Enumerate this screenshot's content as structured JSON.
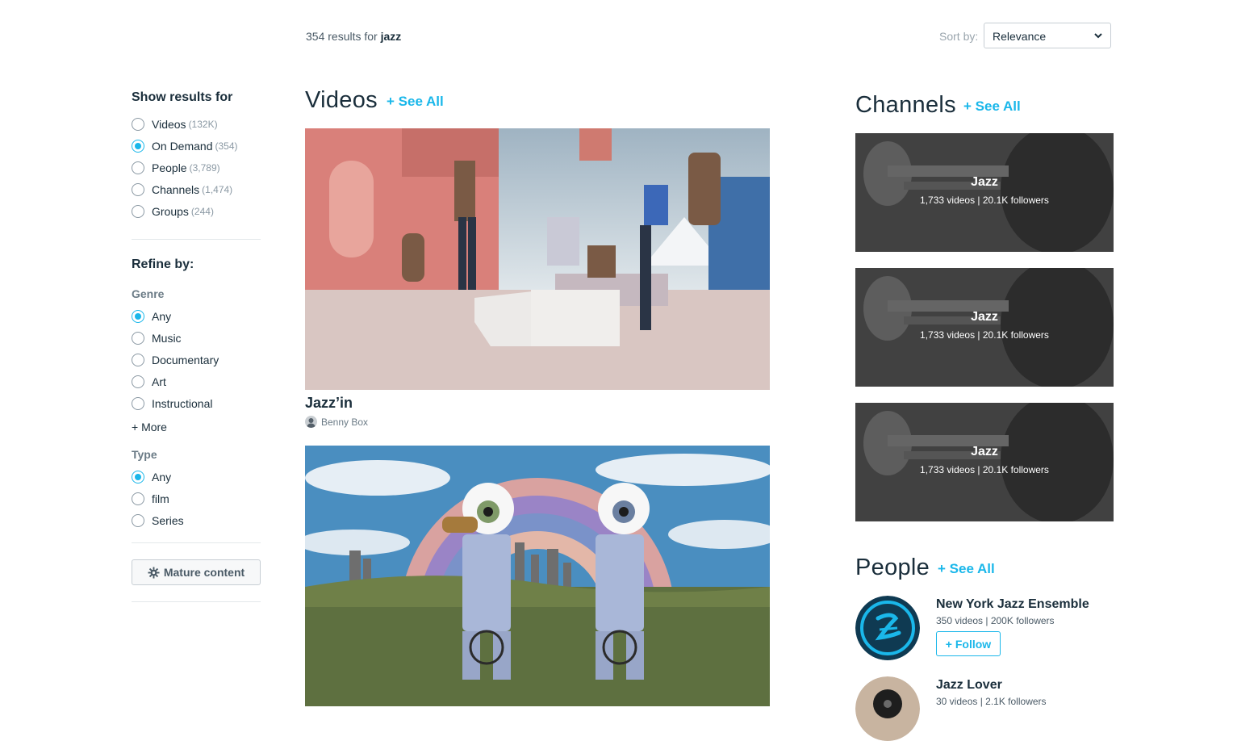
{
  "search": {
    "count": "354",
    "results_text": "results for",
    "query": "jazz",
    "sort_label": "Sort by:",
    "sort_value": "Relevance"
  },
  "sidebar": {
    "show_heading": "Show results for",
    "show_options": [
      {
        "label": "Videos",
        "count": "(132K)",
        "checked": false
      },
      {
        "label": "On Demand",
        "count": "(354)",
        "checked": true
      },
      {
        "label": "People",
        "count": "(3,789)",
        "checked": false
      },
      {
        "label": "Channels",
        "count": "(1,474)",
        "checked": false
      },
      {
        "label": "Groups",
        "count": "(244)",
        "checked": false
      }
    ],
    "refine_heading": "Refine by:",
    "genre_heading": "Genre",
    "genre_options": [
      {
        "label": "Any",
        "checked": true
      },
      {
        "label": "Music",
        "checked": false
      },
      {
        "label": "Documentary",
        "checked": false
      },
      {
        "label": "Art",
        "checked": false
      },
      {
        "label": "Instructional",
        "checked": false
      }
    ],
    "more_label": "+ More",
    "type_heading": "Type",
    "type_options": [
      {
        "label": "Any",
        "checked": true
      },
      {
        "label": "film",
        "checked": false
      },
      {
        "label": "Series",
        "checked": false
      }
    ],
    "mature_label": "Mature content"
  },
  "videos": {
    "heading": "Videos",
    "see_all": "+ See All",
    "items": [
      {
        "title": "Jazz’in",
        "author": "Benny Box"
      }
    ]
  },
  "channels": {
    "heading": "Channels",
    "see_all": "+ See All",
    "items": [
      {
        "name": "Jazz",
        "meta": "1,733 videos | 20.1K followers"
      },
      {
        "name": "Jazz",
        "meta": "1,733 videos | 20.1K followers"
      },
      {
        "name": "Jazz",
        "meta": "1,733 videos | 20.1K followers"
      }
    ]
  },
  "people": {
    "heading": "People",
    "see_all": "+ See All",
    "items": [
      {
        "name": "New York Jazz Ensemble",
        "meta": "350 videos | 200K followers",
        "follow_label": "+ Follow"
      },
      {
        "name": "Jazz Lover",
        "meta": "30 videos | 2.1K followers"
      }
    ]
  },
  "colors": {
    "accent": "#1ab7ea",
    "text": "#1a2e3b"
  }
}
